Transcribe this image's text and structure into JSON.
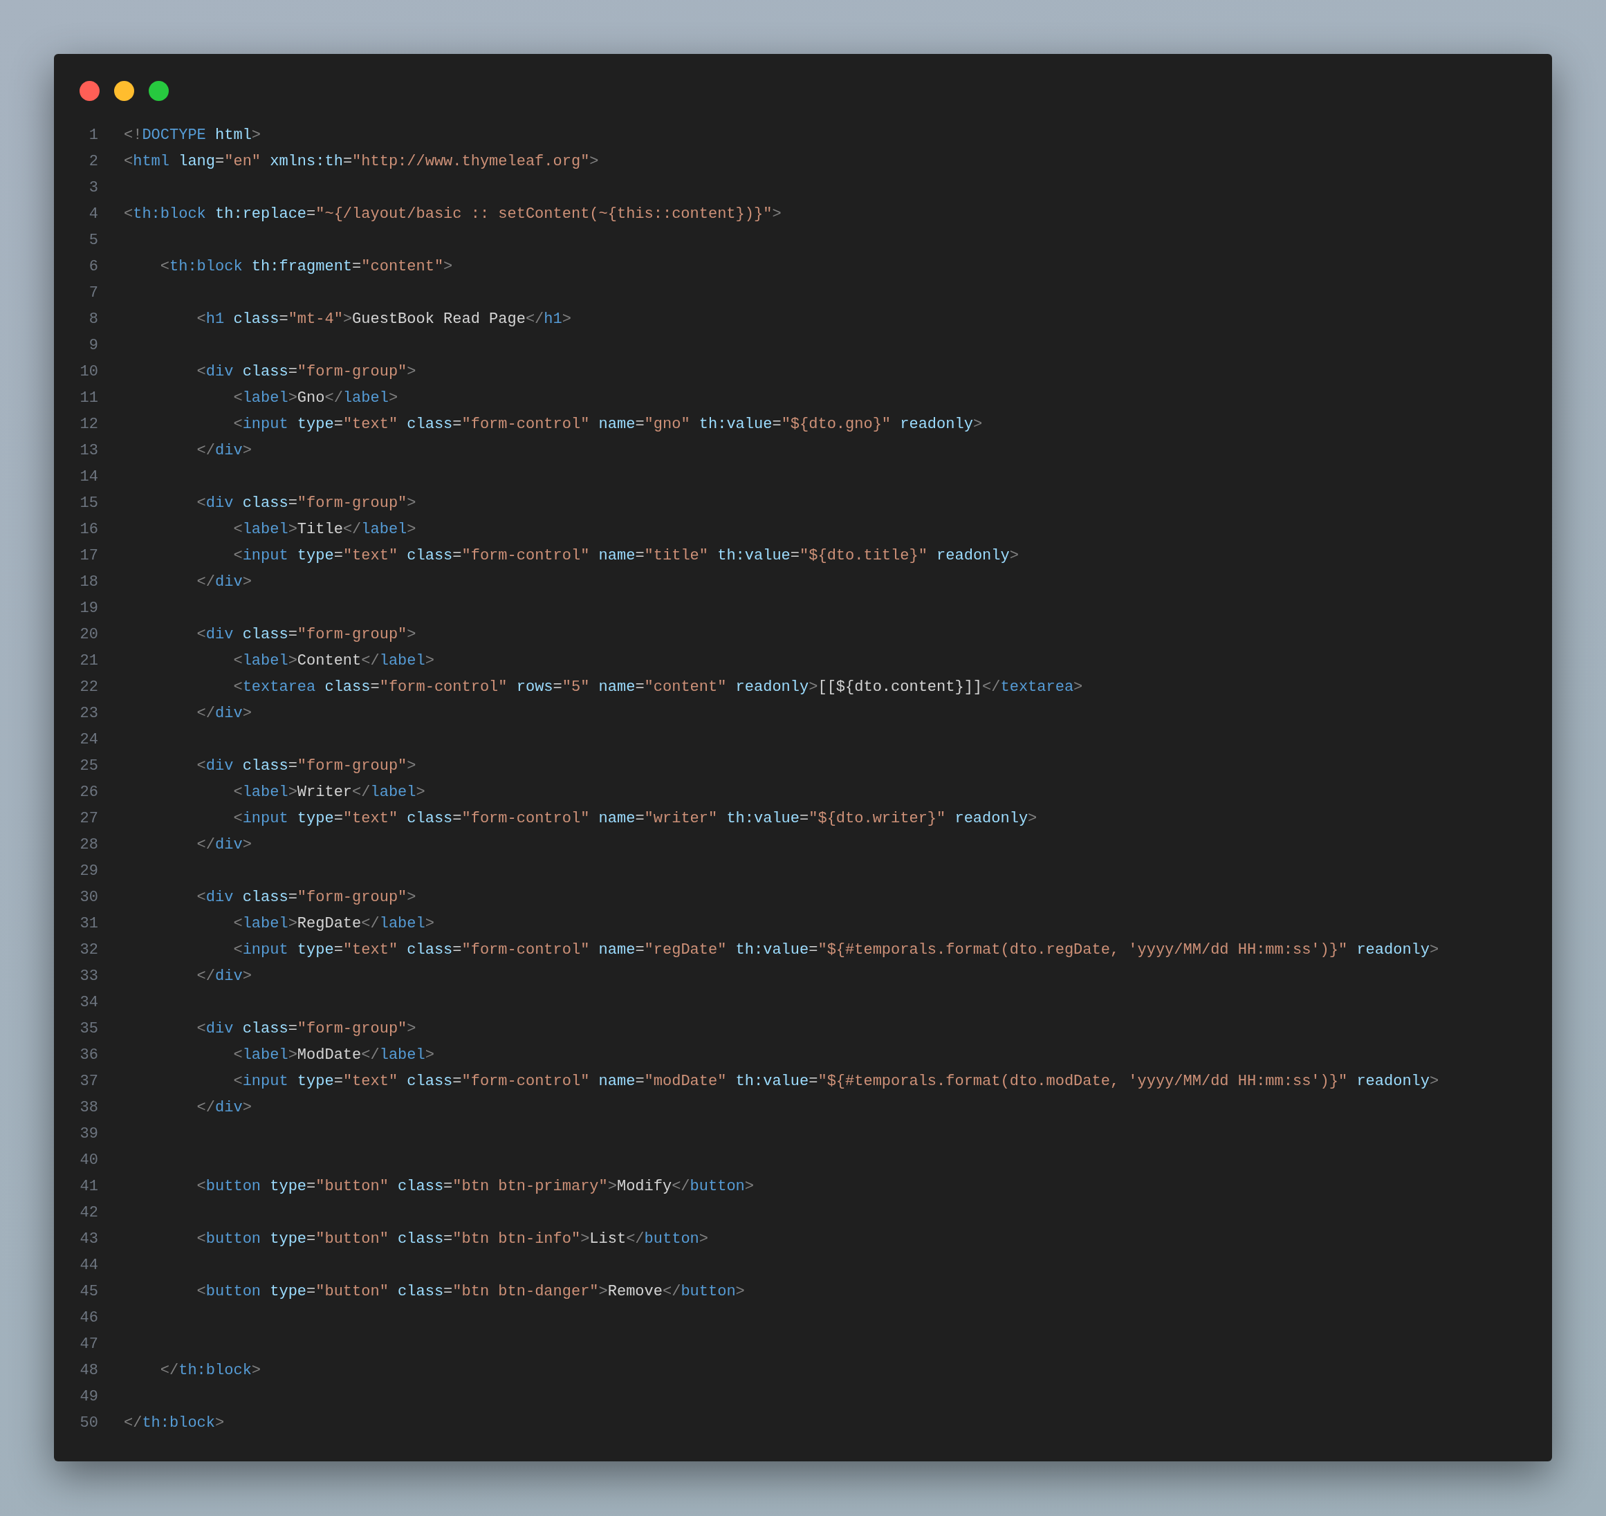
{
  "code_lines": [
    {
      "number": "1",
      "tokens": [
        {
          "kind": "punct",
          "text": "<!"
        },
        {
          "kind": "tag",
          "text": "DOCTYPE "
        },
        {
          "kind": "attr",
          "text": "html"
        },
        {
          "kind": "punct",
          "text": ">"
        }
      ]
    },
    {
      "number": "2",
      "tokens": [
        {
          "kind": "punct",
          "text": "<"
        },
        {
          "kind": "tag",
          "text": "html "
        },
        {
          "kind": "attr",
          "text": "lang"
        },
        {
          "kind": "text",
          "text": "="
        },
        {
          "kind": "string",
          "text": "\"en\" "
        },
        {
          "kind": "attr",
          "text": "xmlns:th"
        },
        {
          "kind": "text",
          "text": "="
        },
        {
          "kind": "string",
          "text": "\"http://www.thymeleaf.org\""
        },
        {
          "kind": "punct",
          "text": ">"
        }
      ]
    },
    {
      "number": "3"
    },
    {
      "number": "4",
      "tokens": [
        {
          "kind": "punct",
          "text": "<"
        },
        {
          "kind": "tag",
          "text": "th:block "
        },
        {
          "kind": "attr",
          "text": "th:replace"
        },
        {
          "kind": "text",
          "text": "="
        },
        {
          "kind": "string",
          "text": "\"~{/layout/basic :: setContent(~{this::content})}\""
        },
        {
          "kind": "punct",
          "text": ">"
        }
      ]
    },
    {
      "number": "5"
    },
    {
      "number": "6",
      "tokens": [
        {
          "kind": "punct",
          "text": "    <"
        },
        {
          "kind": "tag",
          "text": "th:block "
        },
        {
          "kind": "attr",
          "text": "th:fragment"
        },
        {
          "kind": "text",
          "text": "="
        },
        {
          "kind": "string",
          "text": "\"content\""
        },
        {
          "kind": "punct",
          "text": ">"
        }
      ]
    },
    {
      "number": "7"
    },
    {
      "number": "8",
      "tokens": [
        {
          "kind": "punct",
          "text": "        <"
        },
        {
          "kind": "tag",
          "text": "h1 "
        },
        {
          "kind": "attr",
          "text": "class"
        },
        {
          "kind": "text",
          "text": "="
        },
        {
          "kind": "string",
          "text": "\"mt-4\""
        },
        {
          "kind": "punct",
          "text": ">"
        },
        {
          "kind": "text",
          "text": "GuestBook Read Page"
        },
        {
          "kind": "punct",
          "text": "</"
        },
        {
          "kind": "tag",
          "text": "h1"
        },
        {
          "kind": "punct",
          "text": ">"
        }
      ]
    },
    {
      "number": "9"
    },
    {
      "number": "10",
      "tokens": [
        {
          "kind": "punct",
          "text": "        <"
        },
        {
          "kind": "tag",
          "text": "div "
        },
        {
          "kind": "attr",
          "text": "class"
        },
        {
          "kind": "text",
          "text": "="
        },
        {
          "kind": "string",
          "text": "\"form-group\""
        },
        {
          "kind": "punct",
          "text": ">"
        }
      ]
    },
    {
      "number": "11",
      "tokens": [
        {
          "kind": "punct",
          "text": "            <"
        },
        {
          "kind": "tag",
          "text": "label"
        },
        {
          "kind": "punct",
          "text": ">"
        },
        {
          "kind": "text",
          "text": "Gno"
        },
        {
          "kind": "punct",
          "text": "</"
        },
        {
          "kind": "tag",
          "text": "label"
        },
        {
          "kind": "punct",
          "text": ">"
        }
      ]
    },
    {
      "number": "12",
      "tokens": [
        {
          "kind": "punct",
          "text": "            <"
        },
        {
          "kind": "tag",
          "text": "input "
        },
        {
          "kind": "attr",
          "text": "type"
        },
        {
          "kind": "text",
          "text": "="
        },
        {
          "kind": "string",
          "text": "\"text\" "
        },
        {
          "kind": "attr",
          "text": "class"
        },
        {
          "kind": "text",
          "text": "="
        },
        {
          "kind": "string",
          "text": "\"form-control\" "
        },
        {
          "kind": "attr",
          "text": "name"
        },
        {
          "kind": "text",
          "text": "="
        },
        {
          "kind": "string",
          "text": "\"gno\" "
        },
        {
          "kind": "attr",
          "text": "th:value"
        },
        {
          "kind": "text",
          "text": "="
        },
        {
          "kind": "string",
          "text": "\"${dto.gno}\" "
        },
        {
          "kind": "attr",
          "text": "readonly"
        },
        {
          "kind": "punct",
          "text": ">"
        }
      ]
    },
    {
      "number": "13",
      "tokens": [
        {
          "kind": "punct",
          "text": "        </"
        },
        {
          "kind": "tag",
          "text": "div"
        },
        {
          "kind": "punct",
          "text": ">"
        }
      ]
    },
    {
      "number": "14"
    },
    {
      "number": "15",
      "tokens": [
        {
          "kind": "punct",
          "text": "        <"
        },
        {
          "kind": "tag",
          "text": "div "
        },
        {
          "kind": "attr",
          "text": "class"
        },
        {
          "kind": "text",
          "text": "="
        },
        {
          "kind": "string",
          "text": "\"form-group\""
        },
        {
          "kind": "punct",
          "text": ">"
        }
      ]
    },
    {
      "number": "16",
      "tokens": [
        {
          "kind": "punct",
          "text": "            <"
        },
        {
          "kind": "tag",
          "text": "label"
        },
        {
          "kind": "punct",
          "text": ">"
        },
        {
          "kind": "text",
          "text": "Title"
        },
        {
          "kind": "punct",
          "text": "</"
        },
        {
          "kind": "tag",
          "text": "label"
        },
        {
          "kind": "punct",
          "text": ">"
        }
      ]
    },
    {
      "number": "17",
      "tokens": [
        {
          "kind": "punct",
          "text": "            <"
        },
        {
          "kind": "tag",
          "text": "input "
        },
        {
          "kind": "attr",
          "text": "type"
        },
        {
          "kind": "text",
          "text": "="
        },
        {
          "kind": "string",
          "text": "\"text\" "
        },
        {
          "kind": "attr",
          "text": "class"
        },
        {
          "kind": "text",
          "text": "="
        },
        {
          "kind": "string",
          "text": "\"form-control\" "
        },
        {
          "kind": "attr",
          "text": "name"
        },
        {
          "kind": "text",
          "text": "="
        },
        {
          "kind": "string",
          "text": "\"title\" "
        },
        {
          "kind": "attr",
          "text": "th:value"
        },
        {
          "kind": "text",
          "text": "="
        },
        {
          "kind": "string",
          "text": "\"${dto.title}\" "
        },
        {
          "kind": "attr",
          "text": "readonly"
        },
        {
          "kind": "punct",
          "text": ">"
        }
      ]
    },
    {
      "number": "18",
      "tokens": [
        {
          "kind": "punct",
          "text": "        </"
        },
        {
          "kind": "tag",
          "text": "div"
        },
        {
          "kind": "punct",
          "text": ">"
        }
      ]
    },
    {
      "number": "19"
    },
    {
      "number": "20",
      "tokens": [
        {
          "kind": "punct",
          "text": "        <"
        },
        {
          "kind": "tag",
          "text": "div "
        },
        {
          "kind": "attr",
          "text": "class"
        },
        {
          "kind": "text",
          "text": "="
        },
        {
          "kind": "string",
          "text": "\"form-group\""
        },
        {
          "kind": "punct",
          "text": ">"
        }
      ]
    },
    {
      "number": "21",
      "tokens": [
        {
          "kind": "punct",
          "text": "            <"
        },
        {
          "kind": "tag",
          "text": "label"
        },
        {
          "kind": "punct",
          "text": ">"
        },
        {
          "kind": "text",
          "text": "Content"
        },
        {
          "kind": "punct",
          "text": "</"
        },
        {
          "kind": "tag",
          "text": "label"
        },
        {
          "kind": "punct",
          "text": ">"
        }
      ]
    },
    {
      "number": "22",
      "tokens": [
        {
          "kind": "punct",
          "text": "            <"
        },
        {
          "kind": "tag",
          "text": "textarea "
        },
        {
          "kind": "attr",
          "text": "class"
        },
        {
          "kind": "text",
          "text": "="
        },
        {
          "kind": "string",
          "text": "\"form-control\" "
        },
        {
          "kind": "attr",
          "text": "rows"
        },
        {
          "kind": "text",
          "text": "="
        },
        {
          "kind": "string",
          "text": "\"5\" "
        },
        {
          "kind": "attr",
          "text": "name"
        },
        {
          "kind": "text",
          "text": "="
        },
        {
          "kind": "string",
          "text": "\"content\" "
        },
        {
          "kind": "attr",
          "text": "readonly"
        },
        {
          "kind": "punct",
          "text": ">"
        },
        {
          "kind": "text",
          "text": "[[${dto.content}]]"
        },
        {
          "kind": "punct",
          "text": "</"
        },
        {
          "kind": "tag",
          "text": "textarea"
        },
        {
          "kind": "punct",
          "text": ">"
        }
      ]
    },
    {
      "number": "23",
      "tokens": [
        {
          "kind": "punct",
          "text": "        </"
        },
        {
          "kind": "tag",
          "text": "div"
        },
        {
          "kind": "punct",
          "text": ">"
        }
      ]
    },
    {
      "number": "24"
    },
    {
      "number": "25",
      "tokens": [
        {
          "kind": "punct",
          "text": "        <"
        },
        {
          "kind": "tag",
          "text": "div "
        },
        {
          "kind": "attr",
          "text": "class"
        },
        {
          "kind": "text",
          "text": "="
        },
        {
          "kind": "string",
          "text": "\"form-group\""
        },
        {
          "kind": "punct",
          "text": ">"
        }
      ]
    },
    {
      "number": "26",
      "tokens": [
        {
          "kind": "punct",
          "text": "            <"
        },
        {
          "kind": "tag",
          "text": "label"
        },
        {
          "kind": "punct",
          "text": ">"
        },
        {
          "kind": "text",
          "text": "Writer"
        },
        {
          "kind": "punct",
          "text": "</"
        },
        {
          "kind": "tag",
          "text": "label"
        },
        {
          "kind": "punct",
          "text": ">"
        }
      ]
    },
    {
      "number": "27",
      "tokens": [
        {
          "kind": "punct",
          "text": "            <"
        },
        {
          "kind": "tag",
          "text": "input "
        },
        {
          "kind": "attr",
          "text": "type"
        },
        {
          "kind": "text",
          "text": "="
        },
        {
          "kind": "string",
          "text": "\"text\" "
        },
        {
          "kind": "attr",
          "text": "class"
        },
        {
          "kind": "text",
          "text": "="
        },
        {
          "kind": "string",
          "text": "\"form-control\" "
        },
        {
          "kind": "attr",
          "text": "name"
        },
        {
          "kind": "text",
          "text": "="
        },
        {
          "kind": "string",
          "text": "\"writer\" "
        },
        {
          "kind": "attr",
          "text": "th:value"
        },
        {
          "kind": "text",
          "text": "="
        },
        {
          "kind": "string",
          "text": "\"${dto.writer}\" "
        },
        {
          "kind": "attr",
          "text": "readonly"
        },
        {
          "kind": "punct",
          "text": ">"
        }
      ]
    },
    {
      "number": "28",
      "tokens": [
        {
          "kind": "punct",
          "text": "        </"
        },
        {
          "kind": "tag",
          "text": "div"
        },
        {
          "kind": "punct",
          "text": ">"
        }
      ]
    },
    {
      "number": "29"
    },
    {
      "number": "30",
      "tokens": [
        {
          "kind": "punct",
          "text": "        <"
        },
        {
          "kind": "tag",
          "text": "div "
        },
        {
          "kind": "attr",
          "text": "class"
        },
        {
          "kind": "text",
          "text": "="
        },
        {
          "kind": "string",
          "text": "\"form-group\""
        },
        {
          "kind": "punct",
          "text": ">"
        }
      ]
    },
    {
      "number": "31",
      "tokens": [
        {
          "kind": "punct",
          "text": "            <"
        },
        {
          "kind": "tag",
          "text": "label"
        },
        {
          "kind": "punct",
          "text": ">"
        },
        {
          "kind": "text",
          "text": "RegDate"
        },
        {
          "kind": "punct",
          "text": "</"
        },
        {
          "kind": "tag",
          "text": "label"
        },
        {
          "kind": "punct",
          "text": ">"
        }
      ]
    },
    {
      "number": "32",
      "tokens": [
        {
          "kind": "punct",
          "text": "            <"
        },
        {
          "kind": "tag",
          "text": "input "
        },
        {
          "kind": "attr",
          "text": "type"
        },
        {
          "kind": "text",
          "text": "="
        },
        {
          "kind": "string",
          "text": "\"text\" "
        },
        {
          "kind": "attr",
          "text": "class"
        },
        {
          "kind": "text",
          "text": "="
        },
        {
          "kind": "string",
          "text": "\"form-control\" "
        },
        {
          "kind": "attr",
          "text": "name"
        },
        {
          "kind": "text",
          "text": "="
        },
        {
          "kind": "string",
          "text": "\"regDate\" "
        },
        {
          "kind": "attr",
          "text": "th:value"
        },
        {
          "kind": "text",
          "text": "="
        },
        {
          "kind": "string",
          "text": "\"${#temporals.format(dto.regDate, 'yyyy/MM/dd HH:mm:ss')}\" "
        },
        {
          "kind": "attr",
          "text": "readonly"
        },
        {
          "kind": "punct",
          "text": ">"
        }
      ]
    },
    {
      "number": "33",
      "tokens": [
        {
          "kind": "punct",
          "text": "        </"
        },
        {
          "kind": "tag",
          "text": "div"
        },
        {
          "kind": "punct",
          "text": ">"
        }
      ]
    },
    {
      "number": "34"
    },
    {
      "number": "35",
      "tokens": [
        {
          "kind": "punct",
          "text": "        <"
        },
        {
          "kind": "tag",
          "text": "div "
        },
        {
          "kind": "attr",
          "text": "class"
        },
        {
          "kind": "text",
          "text": "="
        },
        {
          "kind": "string",
          "text": "\"form-group\""
        },
        {
          "kind": "punct",
          "text": ">"
        }
      ]
    },
    {
      "number": "36",
      "tokens": [
        {
          "kind": "punct",
          "text": "            <"
        },
        {
          "kind": "tag",
          "text": "label"
        },
        {
          "kind": "punct",
          "text": ">"
        },
        {
          "kind": "text",
          "text": "ModDate"
        },
        {
          "kind": "punct",
          "text": "</"
        },
        {
          "kind": "tag",
          "text": "label"
        },
        {
          "kind": "punct",
          "text": ">"
        }
      ]
    },
    {
      "number": "37",
      "tokens": [
        {
          "kind": "punct",
          "text": "            <"
        },
        {
          "kind": "tag",
          "text": "input "
        },
        {
          "kind": "attr",
          "text": "type"
        },
        {
          "kind": "text",
          "text": "="
        },
        {
          "kind": "string",
          "text": "\"text\" "
        },
        {
          "kind": "attr",
          "text": "class"
        },
        {
          "kind": "text",
          "text": "="
        },
        {
          "kind": "string",
          "text": "\"form-control\" "
        },
        {
          "kind": "attr",
          "text": "name"
        },
        {
          "kind": "text",
          "text": "="
        },
        {
          "kind": "string",
          "text": "\"modDate\" "
        },
        {
          "kind": "attr",
          "text": "th:value"
        },
        {
          "kind": "text",
          "text": "="
        },
        {
          "kind": "string",
          "text": "\"${#temporals.format(dto.modDate, 'yyyy/MM/dd HH:mm:ss')}\" "
        },
        {
          "kind": "attr",
          "text": "readonly"
        },
        {
          "kind": "punct",
          "text": ">"
        }
      ]
    },
    {
      "number": "38",
      "tokens": [
        {
          "kind": "punct",
          "text": "        </"
        },
        {
          "kind": "tag",
          "text": "div"
        },
        {
          "kind": "punct",
          "text": ">"
        }
      ]
    },
    {
      "number": "39"
    },
    {
      "number": "40"
    },
    {
      "number": "41",
      "tokens": [
        {
          "kind": "punct",
          "text": "        <"
        },
        {
          "kind": "tag",
          "text": "button "
        },
        {
          "kind": "attr",
          "text": "type"
        },
        {
          "kind": "text",
          "text": "="
        },
        {
          "kind": "string",
          "text": "\"button\" "
        },
        {
          "kind": "attr",
          "text": "class"
        },
        {
          "kind": "text",
          "text": "="
        },
        {
          "kind": "string",
          "text": "\"btn btn-primary\""
        },
        {
          "kind": "punct",
          "text": ">"
        },
        {
          "kind": "text",
          "text": "Modify"
        },
        {
          "kind": "punct",
          "text": "</"
        },
        {
          "kind": "tag",
          "text": "button"
        },
        {
          "kind": "punct",
          "text": ">"
        }
      ]
    },
    {
      "number": "42"
    },
    {
      "number": "43",
      "tokens": [
        {
          "kind": "punct",
          "text": "        <"
        },
        {
          "kind": "tag",
          "text": "button "
        },
        {
          "kind": "attr",
          "text": "type"
        },
        {
          "kind": "text",
          "text": "="
        },
        {
          "kind": "string",
          "text": "\"button\" "
        },
        {
          "kind": "attr",
          "text": "class"
        },
        {
          "kind": "text",
          "text": "="
        },
        {
          "kind": "string",
          "text": "\"btn btn-info\""
        },
        {
          "kind": "punct",
          "text": ">"
        },
        {
          "kind": "text",
          "text": "List"
        },
        {
          "kind": "punct",
          "text": "</"
        },
        {
          "kind": "tag",
          "text": "button"
        },
        {
          "kind": "punct",
          "text": ">"
        }
      ]
    },
    {
      "number": "44"
    },
    {
      "number": "45",
      "tokens": [
        {
          "kind": "punct",
          "text": "        <"
        },
        {
          "kind": "tag",
          "text": "button "
        },
        {
          "kind": "attr",
          "text": "type"
        },
        {
          "kind": "text",
          "text": "="
        },
        {
          "kind": "string",
          "text": "\"button\" "
        },
        {
          "kind": "attr",
          "text": "class"
        },
        {
          "kind": "text",
          "text": "="
        },
        {
          "kind": "string",
          "text": "\"btn btn-danger\""
        },
        {
          "kind": "punct",
          "text": ">"
        },
        {
          "kind": "text",
          "text": "Remove"
        },
        {
          "kind": "punct",
          "text": "</"
        },
        {
          "kind": "tag",
          "text": "button"
        },
        {
          "kind": "punct",
          "text": ">"
        }
      ]
    },
    {
      "number": "46"
    },
    {
      "number": "47"
    },
    {
      "number": "48",
      "tokens": [
        {
          "kind": "punct",
          "text": "    </"
        },
        {
          "kind": "tag",
          "text": "th:block"
        },
        {
          "kind": "punct",
          "text": ">"
        }
      ]
    },
    {
      "number": "49"
    },
    {
      "number": "50",
      "tokens": [
        {
          "kind": "punct",
          "text": "</"
        },
        {
          "kind": "tag",
          "text": "th:block"
        },
        {
          "kind": "punct",
          "text": ">"
        }
      ]
    }
  ]
}
